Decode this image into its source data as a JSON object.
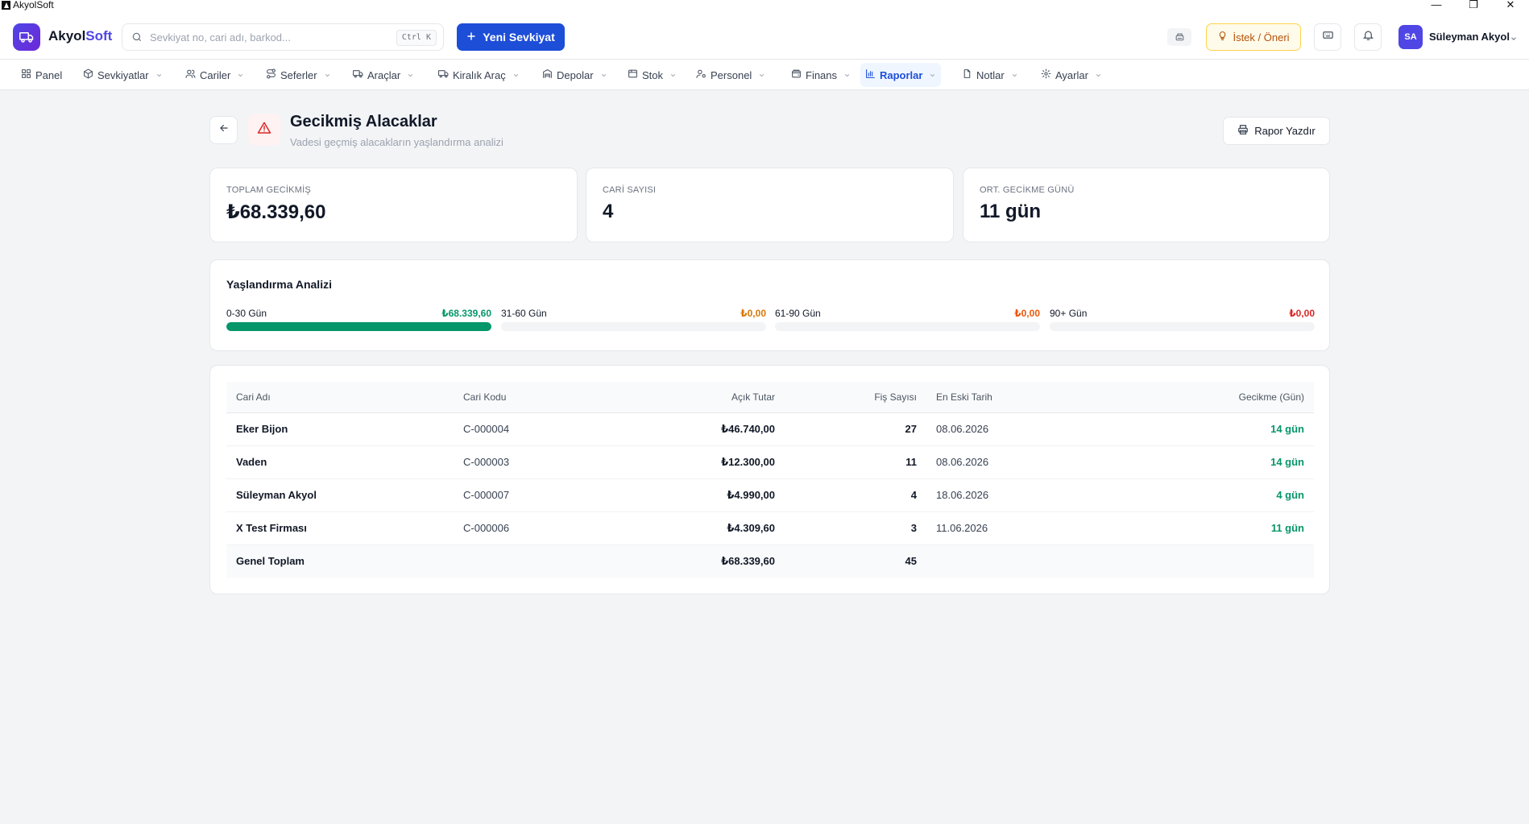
{
  "window": {
    "title": "AkyolSoft",
    "controls": [
      "—",
      "❐",
      "✕"
    ]
  },
  "header": {
    "logo_a": "Akyol",
    "logo_b": "Soft",
    "search_placeholder": "Sevkiyat no, cari adı, barkod...",
    "search_shortcut": "Ctrl K",
    "new_shipment": "Yeni Sevkiyat",
    "suggestion": "İstek / Öneri",
    "user_initials": "SA",
    "user_name": "Süleyman Akyol"
  },
  "nav": [
    {
      "label": "Panel",
      "icon": "grid-icon",
      "dropdown": false
    },
    {
      "label": "Sevkiyatlar",
      "icon": "box-icon",
      "dropdown": true
    },
    {
      "label": "Cariler",
      "icon": "users-icon",
      "dropdown": true
    },
    {
      "label": "Seferler",
      "icon": "route-icon",
      "dropdown": true
    },
    {
      "label": "Araçlar",
      "icon": "truck-icon",
      "dropdown": true
    },
    {
      "label": "Kiralık Araç",
      "icon": "truck-icon",
      "dropdown": true
    },
    {
      "label": "Depolar",
      "icon": "warehouse-icon",
      "dropdown": true
    },
    {
      "label": "Stok",
      "icon": "package-icon",
      "dropdown": true
    },
    {
      "label": "Personel",
      "icon": "user-cog-icon",
      "dropdown": true
    },
    {
      "label": "Finans",
      "icon": "wallet-icon",
      "dropdown": true
    },
    {
      "label": "Raporlar",
      "icon": "bar-chart-icon",
      "dropdown": true,
      "active": true
    },
    {
      "label": "Notlar",
      "icon": "file-icon",
      "dropdown": true
    },
    {
      "label": "Ayarlar",
      "icon": "gear-icon",
      "dropdown": true
    }
  ],
  "page": {
    "title": "Gecikmiş Alacaklar",
    "subtitle": "Vadesi geçmiş alacakların yaşlandırma analizi",
    "print_label": "Rapor Yazdır"
  },
  "stats": [
    {
      "label": "TOPLAM GECİKMİŞ",
      "value": "₺68.339,60"
    },
    {
      "label": "CARİ SAYISI",
      "value": "4"
    },
    {
      "label": "ORT. GECİKME GÜNÜ",
      "value": "11 gün"
    }
  ],
  "aging": {
    "title": "Yaşlandırma Analizi",
    "buckets": [
      {
        "label": "0-30 Gün",
        "amount": "₺68.339,60",
        "fraction": 1.0,
        "color": "#059669"
      },
      {
        "label": "31-60 Gün",
        "amount": "₺0,00",
        "fraction": 0,
        "color": "#d97706"
      },
      {
        "label": "61-90 Gün",
        "amount": "₺0,00",
        "fraction": 0,
        "color": "#ea580c"
      },
      {
        "label": "90+ Gün",
        "amount": "₺0,00",
        "fraction": 0,
        "color": "#dc2626"
      }
    ]
  },
  "table": {
    "columns": [
      "Cari Adı",
      "Cari Kodu",
      "Açık Tutar",
      "Fiş Sayısı",
      "En Eski Tarih",
      "Gecikme (Gün)"
    ],
    "rows": [
      {
        "name": "Eker Bijon",
        "code": "C-000004",
        "amount": "₺46.740,00",
        "count": "27",
        "date": "08.06.2026",
        "delay": "14 gün"
      },
      {
        "name": "Vaden",
        "code": "C-000003",
        "amount": "₺12.300,00",
        "count": "11",
        "date": "08.06.2026",
        "delay": "14 gün"
      },
      {
        "name": "Süleyman Akyol",
        "code": "C-000007",
        "amount": "₺4.990,00",
        "count": "4",
        "date": "18.06.2026",
        "delay": "4 gün"
      },
      {
        "name": "X Test Firması",
        "code": "C-000006",
        "amount": "₺4.309,60",
        "count": "3",
        "date": "11.06.2026",
        "delay": "11 gün"
      }
    ],
    "total_label": "Genel Toplam",
    "total_amount": "₺68.339,60",
    "total_count": "45"
  }
}
